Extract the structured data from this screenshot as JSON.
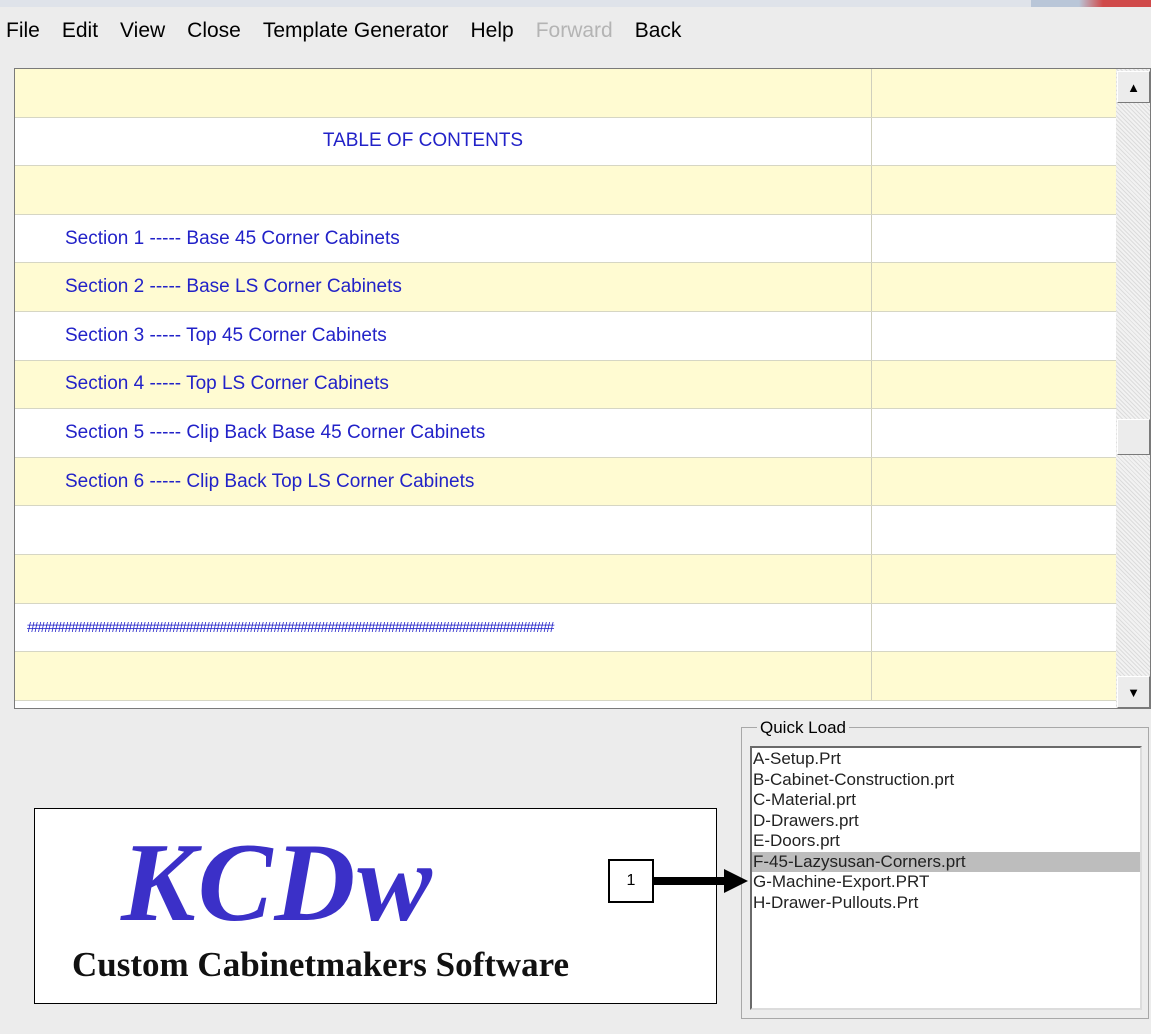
{
  "menu": {
    "file": "File",
    "edit": "Edit",
    "view": "View",
    "close": "Close",
    "template_generator": "Template Generator",
    "help": "Help",
    "forward": "Forward",
    "back": "Back"
  },
  "document": {
    "rows": [
      {
        "text": ""
      },
      {
        "text": "TABLE OF CONTENTS"
      },
      {
        "text": ""
      },
      {
        "text": "Section 1  ----- Base 45 Corner Cabinets"
      },
      {
        "text": "Section 2  ----- Base LS Corner Cabinets"
      },
      {
        "text": "Section 3  ----- Top 45 Corner Cabinets"
      },
      {
        "text": "Section 4  ----- Top LS Corner Cabinets"
      },
      {
        "text": "Section 5  ----- Clip Back Base 45 Corner Cabinets"
      },
      {
        "text": "Section 6  ----- Clip Back Top LS Corner Cabinets"
      },
      {
        "text": ""
      },
      {
        "text": ""
      },
      {
        "text": "##############################################################################"
      },
      {
        "text": ""
      }
    ],
    "scroll_position": 0.55
  },
  "logo": {
    "mark": "KCDw",
    "tagline": "Custom Cabinetmakers Software"
  },
  "quick_load": {
    "legend": "Quick Load",
    "items": [
      "A-Setup.Prt",
      "B-Cabinet-Construction.prt",
      "C-Material.prt",
      "D-Drawers.prt",
      "E-Doors.prt",
      "F-45-Lazysusan-Corners.prt",
      "G-Machine-Export.PRT",
      "H-Drawer-Pullouts.Prt"
    ],
    "selected": "F-45-Lazysusan-Corners.prt"
  },
  "annotation": {
    "label": "1"
  },
  "colors": {
    "link_text": "#2222c8",
    "row_yellow": "#fffbd2",
    "logo_blue": "#3b30c8",
    "selection": "#bdbdbd"
  }
}
